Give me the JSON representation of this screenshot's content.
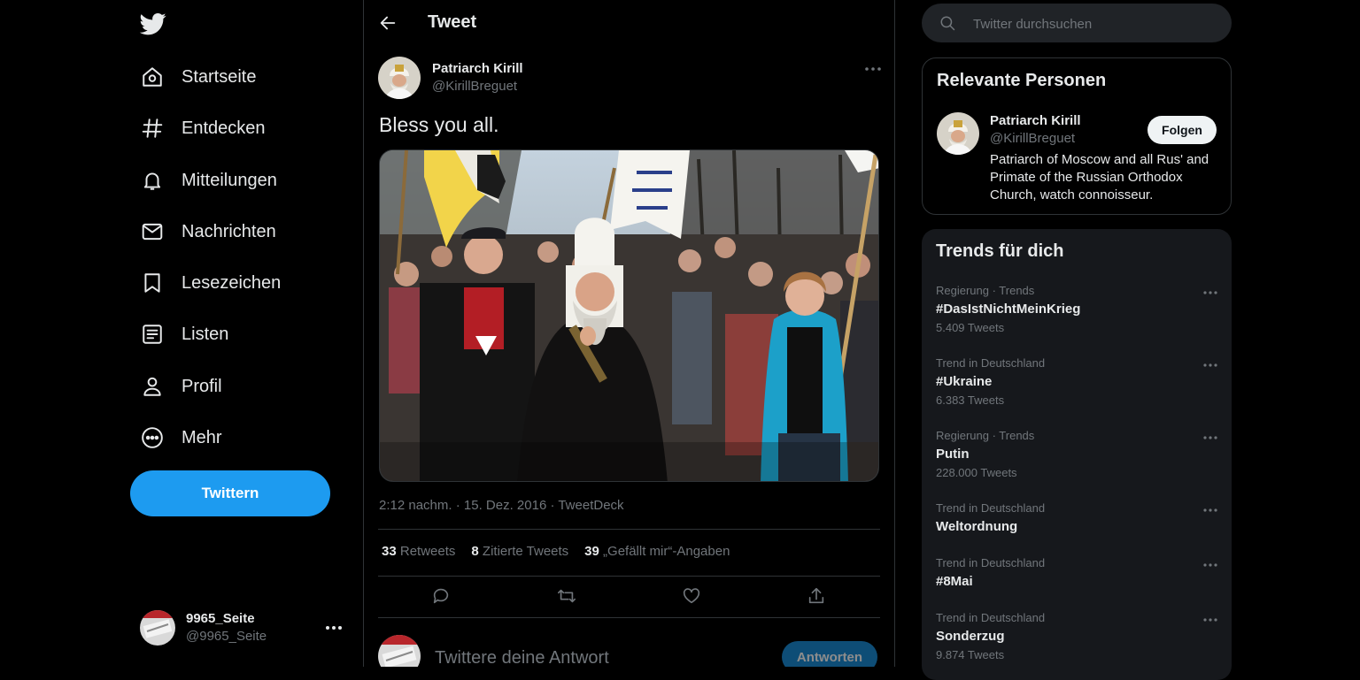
{
  "nav": {
    "logo_icon": "twitter-bird-icon",
    "items": [
      {
        "label": "Startseite",
        "icon": "home-icon"
      },
      {
        "label": "Entdecken",
        "icon": "hashtag-icon"
      },
      {
        "label": "Mitteilungen",
        "icon": "bell-icon"
      },
      {
        "label": "Nachrichten",
        "icon": "mail-icon"
      },
      {
        "label": "Lesezeichen",
        "icon": "bookmark-icon"
      },
      {
        "label": "Listen",
        "icon": "list-icon"
      },
      {
        "label": "Profil",
        "icon": "profile-icon"
      },
      {
        "label": "Mehr",
        "icon": "more-circle-icon"
      }
    ],
    "tweet_button": "Twittern",
    "account": {
      "name": "9965_Seite",
      "handle": "@9965_Seite"
    }
  },
  "main": {
    "header_title": "Tweet",
    "tweet": {
      "author_name": "Patriarch Kirill",
      "author_handle": "@KirillBreguet",
      "text": "Bless you all.",
      "meta": "2:12 nachm. · 15. Dez. 2016 · TweetDeck",
      "stats": {
        "retweets_count": "33",
        "retweets_label": "Retweets",
        "quotes_count": "8",
        "quotes_label": "Zitierte Tweets",
        "likes_count": "39",
        "likes_label": "„Gefällt mir“-Angaben"
      }
    },
    "reply": {
      "placeholder": "Twittere deine Antwort",
      "button": "Antworten"
    }
  },
  "sidebar": {
    "search_placeholder": "Twitter durchsuchen",
    "relevant": {
      "title": "Relevante Personen",
      "person": {
        "name": "Patriarch Kirill",
        "handle": "@KirillBreguet",
        "follow_label": "Folgen",
        "bio": "Patriarch of Moscow and all Rus' and Primate of the Russian Orthodox Church, watch connoisseur."
      }
    },
    "trends": {
      "title": "Trends für dich",
      "items": [
        {
          "context": "Regierung · Trends",
          "name": "#DasIstNichtMeinKrieg",
          "count": "5.409 Tweets"
        },
        {
          "context": "Trend in Deutschland",
          "name": "#Ukraine",
          "count": "6.383 Tweets"
        },
        {
          "context": "Regierung · Trends",
          "name": "Putin",
          "count": "228.000 Tweets"
        },
        {
          "context": "Trend in Deutschland",
          "name": "Weltordnung",
          "count": ""
        },
        {
          "context": "Trend in Deutschland",
          "name": "#8Mai",
          "count": ""
        },
        {
          "context": "Trend in Deutschland",
          "name": "Sonderzug",
          "count": "9.874 Tweets"
        }
      ]
    }
  },
  "colors": {
    "accent": "#1d9bf0",
    "background": "#000000",
    "muted_text": "#71767b",
    "border": "#2f3336"
  }
}
